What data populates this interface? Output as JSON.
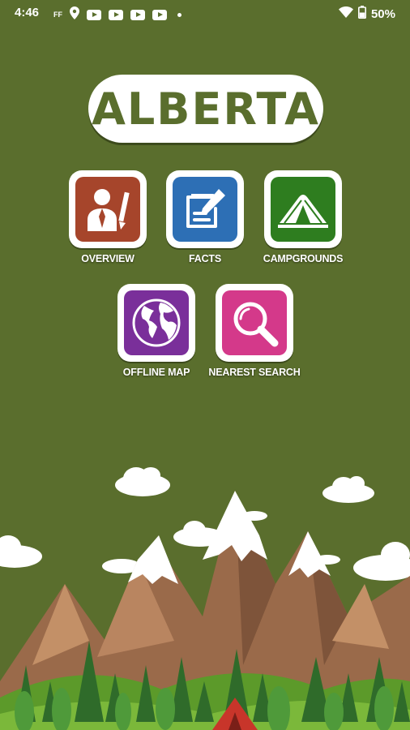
{
  "status_bar": {
    "time": "4:46",
    "battery": "50%"
  },
  "app": {
    "title": "ALBERTA"
  },
  "menu": [
    {
      "label": "OVERVIEW",
      "color": "#a6452b",
      "icon": "person-with-pencil-icon"
    },
    {
      "label": "FACTS",
      "color": "#2d6fb5",
      "icon": "note-edit-icon"
    },
    {
      "label": "CAMPGROUNDS",
      "color": "#2e7d1f",
      "icon": "tent-icon"
    },
    {
      "label": "OFFLINE MAP",
      "color": "#7a2f9a",
      "icon": "globe-icon"
    },
    {
      "label": "NEAREST SEARCH",
      "color": "#d4398a",
      "icon": "magnifier-icon"
    }
  ],
  "colors": {
    "background": "#5a6e2d"
  }
}
